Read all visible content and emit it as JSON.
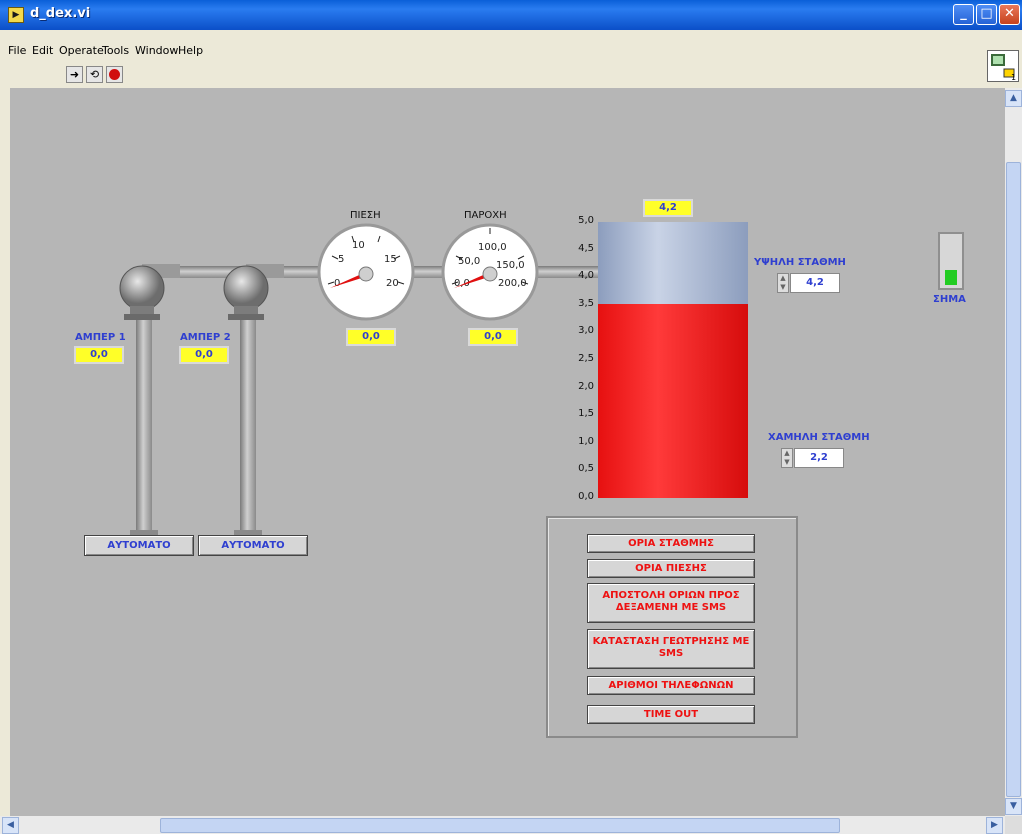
{
  "window": {
    "title": "d_dex.vi",
    "title_icon": "vi-icon"
  },
  "menu": [
    "File",
    "Edit",
    "Operate",
    "Tools",
    "Window",
    "Help"
  ],
  "toolbar": {
    "run_icon": "run-arrow-icon",
    "run_continuous_icon": "run-continuous-icon",
    "abort_icon": "abort-stop-icon"
  },
  "pumps": [
    {
      "amp_label": "ΑΜΠΕΡ 1",
      "amp_value": "0,0",
      "mode": "ΑΥΤΟΜΑΤΟ"
    },
    {
      "amp_label": "ΑΜΠΕΡ 2",
      "amp_value": "0,0",
      "mode": "ΑΥΤΟΜΑΤΟ"
    }
  ],
  "gauges": {
    "pressure": {
      "label": "ΠΙΕΣΗ",
      "ticks": [
        "0",
        "5",
        "10",
        "15",
        "20"
      ],
      "value": "0,0",
      "value_num": 0
    },
    "flow": {
      "label": "ΠΑΡΟΧΗ",
      "ticks": [
        "0,0",
        "50,0",
        "100,0",
        "150,0",
        "200,0"
      ],
      "value": "0,0",
      "value_num": 0
    }
  },
  "tank": {
    "value": "4,2",
    "level": 4.2,
    "max": 5,
    "scale": [
      "5,0",
      "4,5",
      "4,0",
      "3,5",
      "3,0",
      "2,5",
      "2,0",
      "1,5",
      "1,0",
      "0,5",
      "0,0"
    ],
    "fill_color": "#ff1a1a"
  },
  "limits": {
    "high_label": "ΥΨΗΛΗ ΣΤΑΘΜΗ",
    "high_value": "4,2",
    "low_label": "ΧΑΜΗΛΗ ΣΤΑΘΜΗ",
    "low_value": "2,2"
  },
  "signal": {
    "label": "ΣΗΜΑ",
    "level_fraction": 0.28,
    "color": "#22cc22"
  },
  "buttons": [
    "ΟΡΙΑ ΣΤΑΘΜΗΣ",
    "ΟΡΙΑ ΠΙΕΣΗΣ",
    "ΑΠΟΣΤΟΛΗ ΟΡΙΩΝ ΠΡΟΣ ΔΕΞΑΜΕΝΗ ΜΕ SMS",
    "ΚΑΤΑΣΤΑΣΗ ΓΕΩΤΡΗΣΗΣ ΜΕ SMS",
    "ΑΡΙΘΜΟΙ ΤΗΛΕΦΩΝΩΝ",
    "TIME OUT"
  ]
}
